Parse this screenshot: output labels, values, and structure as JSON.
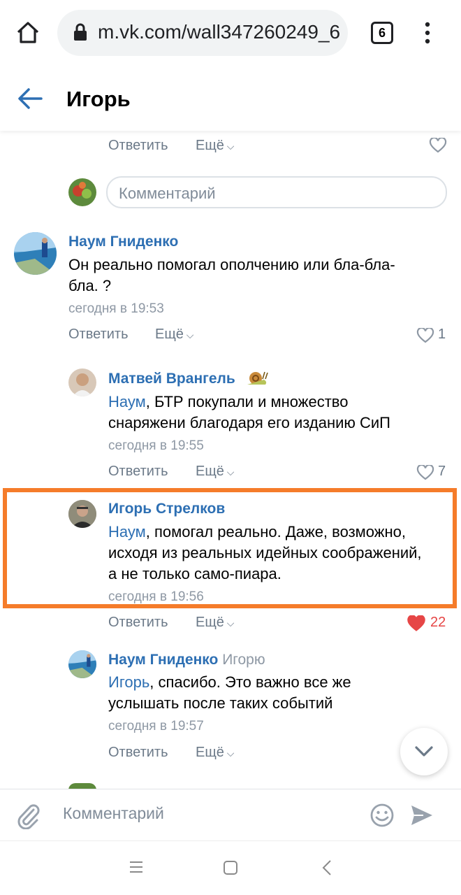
{
  "browser": {
    "url": "m.vk.com/wall347260249_6",
    "tab_count": "6"
  },
  "header": {
    "title": "Игорь"
  },
  "top_actions": {
    "reply": "Ответить",
    "more": "Ещё"
  },
  "comment_input": {
    "placeholder": "Комментарий"
  },
  "comments": [
    {
      "author": "Наум Гниденко",
      "lines": [
        "Он реально помогал ополчению или бла-бла-",
        "бла. ?"
      ],
      "time": "сегодня в 19:53",
      "reply": "Ответить",
      "more": "Ещё",
      "likes": "1"
    },
    {
      "author": "Матвей Врангель",
      "mention": "Наум",
      "lines": [
        ", БТР покупали и множество",
        "снаряжени благодаря его изданию СиП"
      ],
      "time": "сегодня в 19:55",
      "reply": "Ответить",
      "more": "Ещё",
      "likes": "7"
    },
    {
      "author": "Игорь Стрелков",
      "mention": "Наум",
      "lines": [
        ", помогал реально. Даже, возможно,",
        "исходя из реальных идейных соображений,",
        "а не только само-пиара."
      ],
      "time": "сегодня в 19:56",
      "reply": "Ответить",
      "more": "Ещё",
      "likes": "22"
    },
    {
      "author": "Наум Гниденко",
      "reply_to": "Игорю",
      "mention": "Игорь",
      "lines": [
        ", спасибо. Это важно все же",
        "услышать после таких событий"
      ],
      "time": "сегодня в 19:57",
      "reply": "Ответить",
      "more": "Ещё"
    }
  ],
  "bottom_input": {
    "placeholder": "Комментарий"
  },
  "colors": {
    "link": "#2d6fb3",
    "highlight": "#f57c2a",
    "liked": "#e64646"
  }
}
